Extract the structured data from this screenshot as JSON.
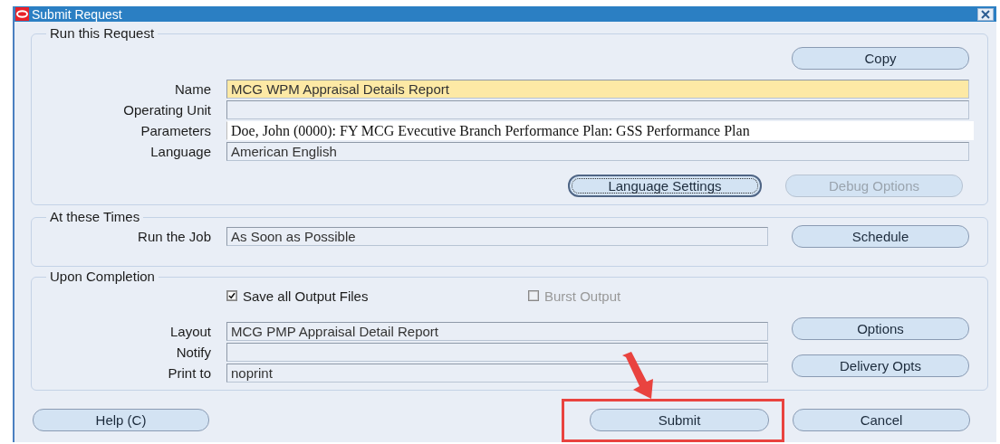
{
  "window": {
    "title": "Submit Request"
  },
  "run_this_request": {
    "legend": "Run this Request",
    "copy_button": {
      "label": "Copy",
      "disabled": false
    },
    "fields": [
      {
        "label": "Name",
        "value": "MCG WPM Appraisal Details Report",
        "kind": "required"
      },
      {
        "label": "Operating Unit"
      },
      {
        "label": "Parameters",
        "value": "Doe, John (0000): FY MCG Evecutive Branch Performance Plan: GSS Performance Plan",
        "kind": "serif"
      },
      {
        "label": "Language",
        "value": "American English"
      }
    ],
    "buttons": [
      {
        "label": "Language Settings",
        "disabled": false,
        "focused": true
      },
      {
        "label": "Debug Options",
        "disabled": true,
        "focused": false
      }
    ]
  },
  "at_these_times": {
    "legend": "At these Times",
    "fields": [
      {
        "label": "Run the Job",
        "value": "As Soon as Possible"
      }
    ],
    "button": {
      "label": "Schedule",
      "disabled": false
    }
  },
  "upon_completion": {
    "legend": "Upon Completion",
    "checkboxes": [
      {
        "label": "Save all Output Files",
        "checked": true,
        "disabled": false
      },
      {
        "label": "Burst Output",
        "checked": false,
        "disabled": true
      }
    ],
    "fields": [
      {
        "label": "Layout",
        "value": "MCG PMP Appraisal Detail Report"
      },
      {
        "label": "Notify"
      },
      {
        "label": "Print to",
        "value": "noprint"
      }
    ],
    "buttons": [
      {
        "label": "Options",
        "disabled": false
      },
      {
        "label": "Delivery Opts",
        "disabled": false
      }
    ]
  },
  "footer_buttons": [
    {
      "label": "Help (C)",
      "highlighted": false
    },
    {
      "label": "Submit",
      "highlighted": true
    },
    {
      "label": "Cancel",
      "highlighted": false
    }
  ]
}
